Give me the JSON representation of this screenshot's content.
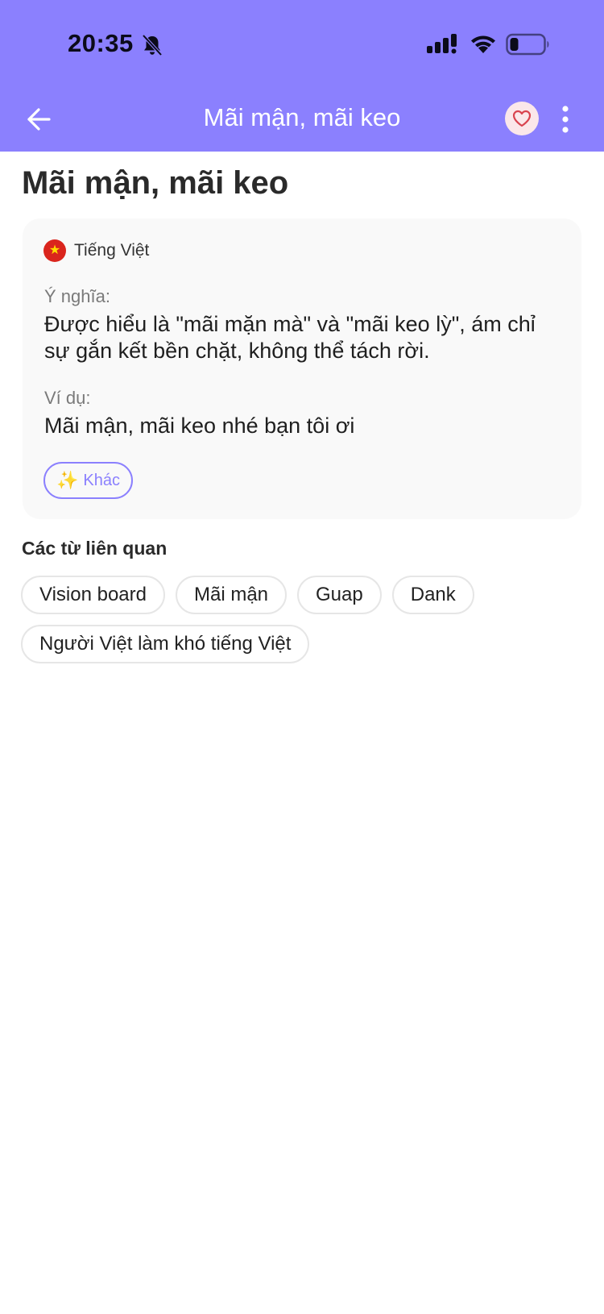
{
  "status_bar": {
    "time": "20:35"
  },
  "app_bar": {
    "title": "Mãi mận, mãi keo"
  },
  "term": {
    "title": "Mãi mận, mãi keo"
  },
  "card": {
    "language": "Tiếng Việt",
    "flag_star": "★",
    "meaning_label": "Ý nghĩa:",
    "meaning_text": "Được hiểu là \"mãi mặn mà\" và \"mãi keo lỳ\", ám chỉ sự gắn kết bền chặt, không thể tách rời.",
    "example_label": "Ví dụ:",
    "example_text": "Mãi mận, mãi keo nhé bạn tôi ơi",
    "more_button": {
      "icon": "✨",
      "label": "Khác"
    }
  },
  "related": {
    "title": "Các từ liên quan",
    "items": [
      "Vision board",
      "Mãi mận",
      "Guap",
      "Dank",
      "Người Việt làm khó tiếng Việt"
    ]
  },
  "colors": {
    "accent": "#8b80fe",
    "favorite_bg": "#fbe7ea",
    "favorite_heart": "#d9434f"
  }
}
